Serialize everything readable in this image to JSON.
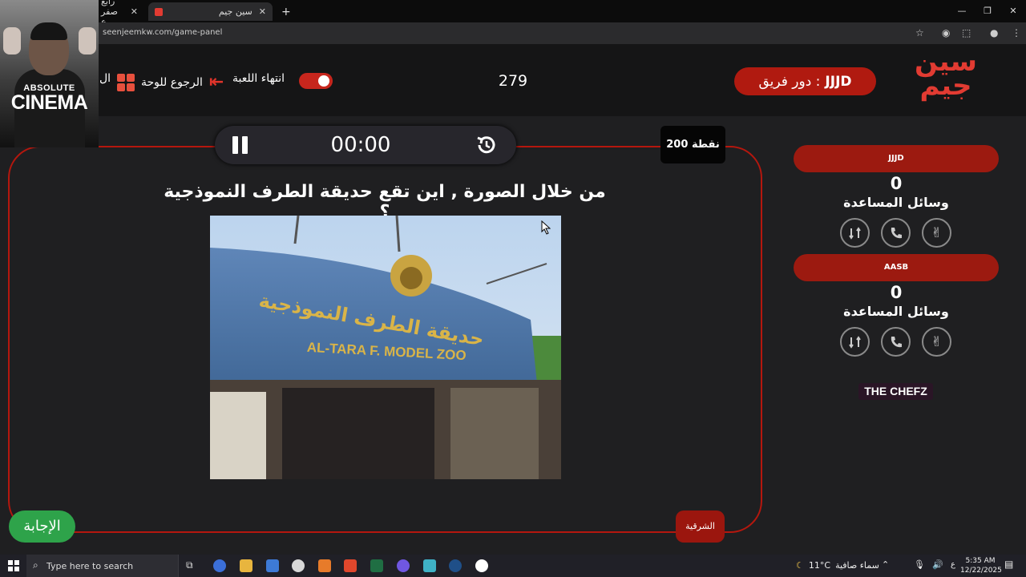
{
  "browser": {
    "tabs": [
      {
        "label": "رابع صفر ع",
        "active": false
      },
      {
        "label": "سين جيم",
        "active": true
      }
    ],
    "url": "seenjeemkw.com/game-panel",
    "new_tab": "+"
  },
  "webcam": {
    "line1": "ABSOLUTE",
    "line2": "CINEMA"
  },
  "header": {
    "logo_top": "سين",
    "logo_bottom": "جيم",
    "turn_label": "دور فريق :",
    "turn_team": "JJJD",
    "score": "279",
    "end_game_label": "انتهاء اللعبة",
    "back_label": "الرجوع للوحة",
    "cut_label": "ال"
  },
  "game": {
    "time": "00:00",
    "points": "200 نقطة",
    "question": "من خلال الصورة , اين تقع حديقة الطرف النموذجية ؟",
    "sign_arabic": "حديقة الطرف النموذجية",
    "sign_english": "AL-TARA F. MODEL ZOO",
    "answer_button": "الإجابة",
    "category": "الشرقية"
  },
  "teams": [
    {
      "name": "JJJD",
      "score": "0",
      "help_label": "وسائل المساعدة"
    },
    {
      "name": "AASB",
      "score": "0",
      "help_label": "وسائل المساعدة"
    }
  ],
  "sponsor": "THE CHEFZ",
  "taskbar": {
    "search_placeholder": "Type here to search",
    "temperature": "11°C",
    "weather": "سماء صافية",
    "lang": "ع",
    "time": "5:35 AM",
    "date": "12/22/2025"
  },
  "colors": {
    "accent": "#b5170e",
    "answer": "#2ea34a",
    "panel": "#1f1f21"
  }
}
